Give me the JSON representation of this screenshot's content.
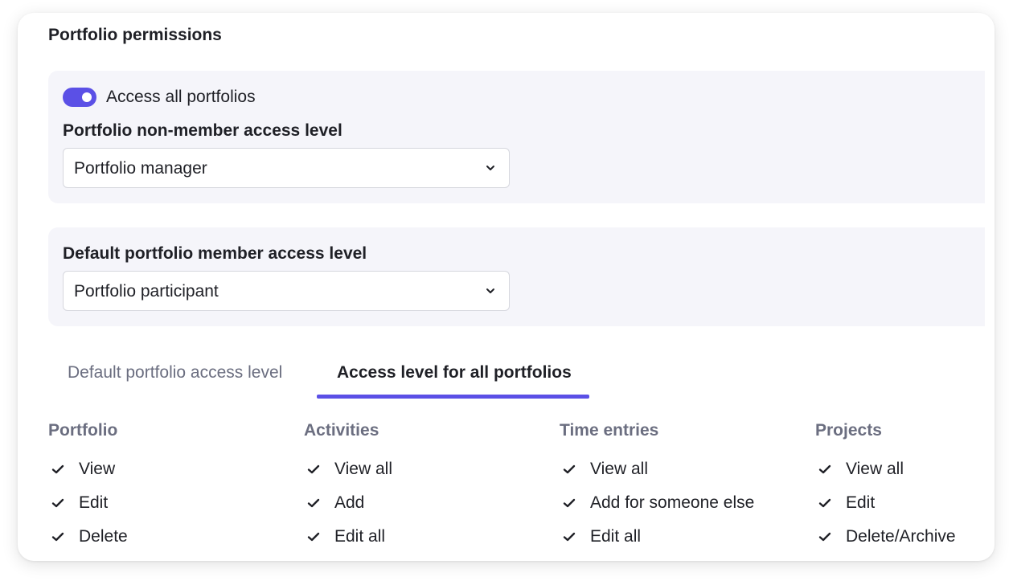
{
  "title": "Portfolio permissions",
  "access_all": {
    "label": "Access all portfolios",
    "enabled": true
  },
  "non_member": {
    "label": "Portfolio non-member access level",
    "value": "Portfolio manager"
  },
  "member_default": {
    "label": "Default portfolio member access level",
    "value": "Portfolio participant"
  },
  "tabs": [
    {
      "label": "Default portfolio access level",
      "active": false
    },
    {
      "label": "Access level for all portfolios",
      "active": true
    }
  ],
  "columns": [
    {
      "title": "Portfolio",
      "items": [
        "View",
        "Edit",
        "Delete"
      ]
    },
    {
      "title": "Activities",
      "items": [
        "View all",
        "Add",
        "Edit all"
      ]
    },
    {
      "title": "Time entries",
      "items": [
        "View all",
        "Add for someone else",
        "Edit all"
      ]
    },
    {
      "title": "Projects",
      "items": [
        "View all",
        "Edit",
        "Delete/Archive"
      ]
    }
  ],
  "icons": {
    "toggle": "toggle-on-icon",
    "dropdown": "chevron-down-icon",
    "permission": "checkmark-icon"
  },
  "colors": {
    "accent": "#5b50e6",
    "panel_bg": "#f5f5fa",
    "muted_text": "#6b6e80"
  }
}
